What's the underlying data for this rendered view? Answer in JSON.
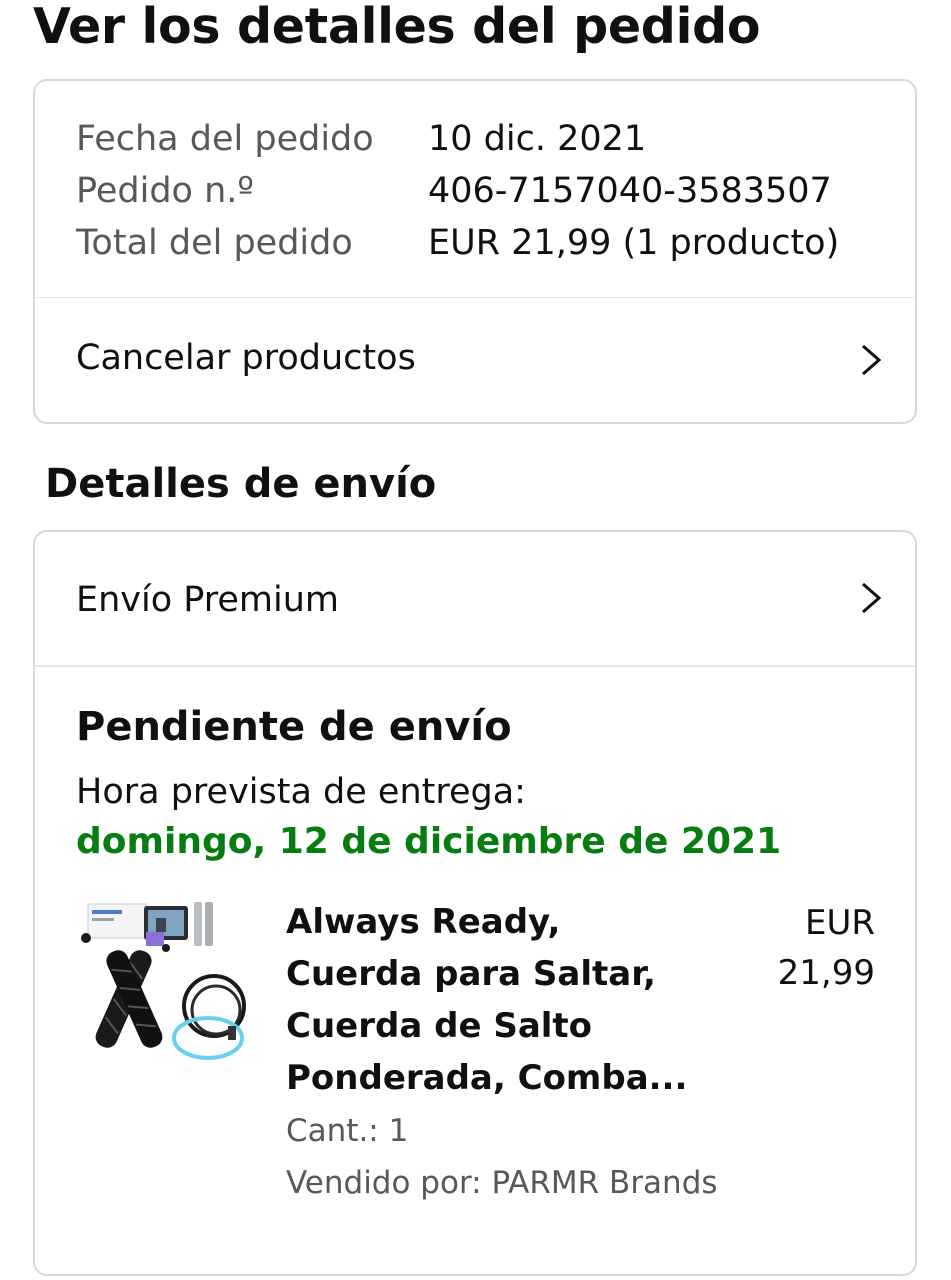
{
  "page": {
    "title": "Ver los detalles del pedido"
  },
  "order_summary": {
    "date_label": "Fecha del pedido",
    "date_value": "10 dic. 2021",
    "number_label": "Pedido n.º",
    "number_value": "406-7157040-3583507",
    "total_label": "Total del pedido",
    "total_value": "EUR 21,99 (1 producto)",
    "cancel_label": "Cancelar productos"
  },
  "shipping": {
    "section_title": "Detalles de envío",
    "method_label": "Envío Premium",
    "status_title": "Pendiente de envío",
    "delivery_label": "Hora prevista de entrega:",
    "delivery_date": "domingo, 12 de diciembre de 2021",
    "delivery_date_color": "#067d11"
  },
  "product": {
    "title": "Always Ready,\nCuerda para Saltar,\nCuerda de Salto\nPonderada, Comba...",
    "price": "EUR\n21,99",
    "quantity": "Cant.: 1",
    "seller": "Vendido por: PARMR Brands",
    "image_icon": "jump-rope-product-image"
  },
  "icons": {
    "chevron": "chevron-right-icon"
  }
}
